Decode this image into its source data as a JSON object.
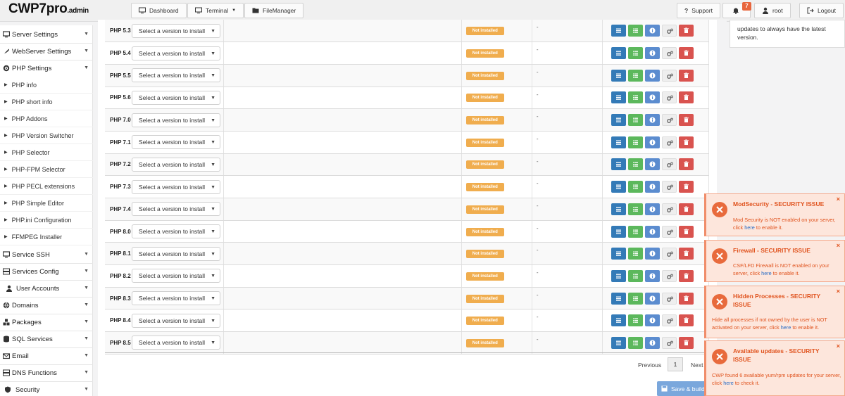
{
  "header": {
    "brand": "CWP7pro",
    "brand_suffix": ".admin",
    "dashboard": "Dashboard",
    "terminal": "Terminal",
    "filemanager": "FileManager",
    "support": "Support",
    "notifications_count": "7",
    "user": "root",
    "logout": "Logout"
  },
  "sidebar": {
    "server_settings": "Server Settings",
    "webserver_settings": "WebServer Settings",
    "php_settings": "PHP Settings",
    "sub": [
      "PHP info",
      "PHP short info",
      "PHP Addons",
      "PHP Version Switcher",
      "PHP Selector",
      "PHP-FPM Selector",
      "PHP PECL extensions",
      "PHP Simple Editor",
      "PHP.ini Configuration",
      "FFMPEG Installer"
    ],
    "service_ssh": "Service SSH",
    "services_config": "Services Config",
    "user_accounts": "User Accounts",
    "domains": "Domains",
    "packages": "Packages",
    "sql_services": "SQL Services",
    "email": "Email",
    "dns_functions": "DNS Functions",
    "security": "Security"
  },
  "table": {
    "select_placeholder": "Select a version to install",
    "status_label": "Not installed",
    "version_placeholder": "-",
    "rows": [
      "PHP 5.3",
      "PHP 5.4",
      "PHP 5.5",
      "PHP 5.6",
      "PHP 7.0",
      "PHP 7.1",
      "PHP 7.2",
      "PHP 7.3",
      "PHP 7.4",
      "PHP 8.0",
      "PHP 8.1",
      "PHP 8.2",
      "PHP 8.3",
      "PHP 8.4",
      "PHP 8.5"
    ]
  },
  "pagination": {
    "previous": "Previous",
    "current": "1",
    "next": "Next"
  },
  "save_button": "Save & build",
  "info_box": {
    "line1": "updates to always have the latest",
    "line2": "version."
  },
  "notifications": [
    {
      "title": "ModSecurity - SECURITY ISSUE",
      "body_pre": "Mod Security is NOT enabled on your server, click ",
      "link": "here",
      "body_post": " to enable it."
    },
    {
      "title": "Firewall - SECURITY ISSUE",
      "body_pre": "CSF/LFD Firewall is NOT enabled on your server, click ",
      "link": "here",
      "body_post": " to enable it."
    },
    {
      "title": "Hidden Processes - SECURITY ISSUE",
      "body_pre": "Hide all processes if not owned by the user is NOT activated on your server, click ",
      "link": "here",
      "body_post": " to enable it."
    },
    {
      "title": "Available updates - SECURITY ISSUE",
      "body_pre": "CWP found 6 available yum/rpm updates for your server, click ",
      "link": "here",
      "body_post": " to check it."
    }
  ],
  "colors": {
    "primary": "#337ab7",
    "success": "#5cb85c",
    "info": "#5b8ccf",
    "danger": "#d9534f",
    "warning": "#f0ad4e",
    "notif_bg": "#fde6dc",
    "notif_fg": "#e0531e"
  }
}
